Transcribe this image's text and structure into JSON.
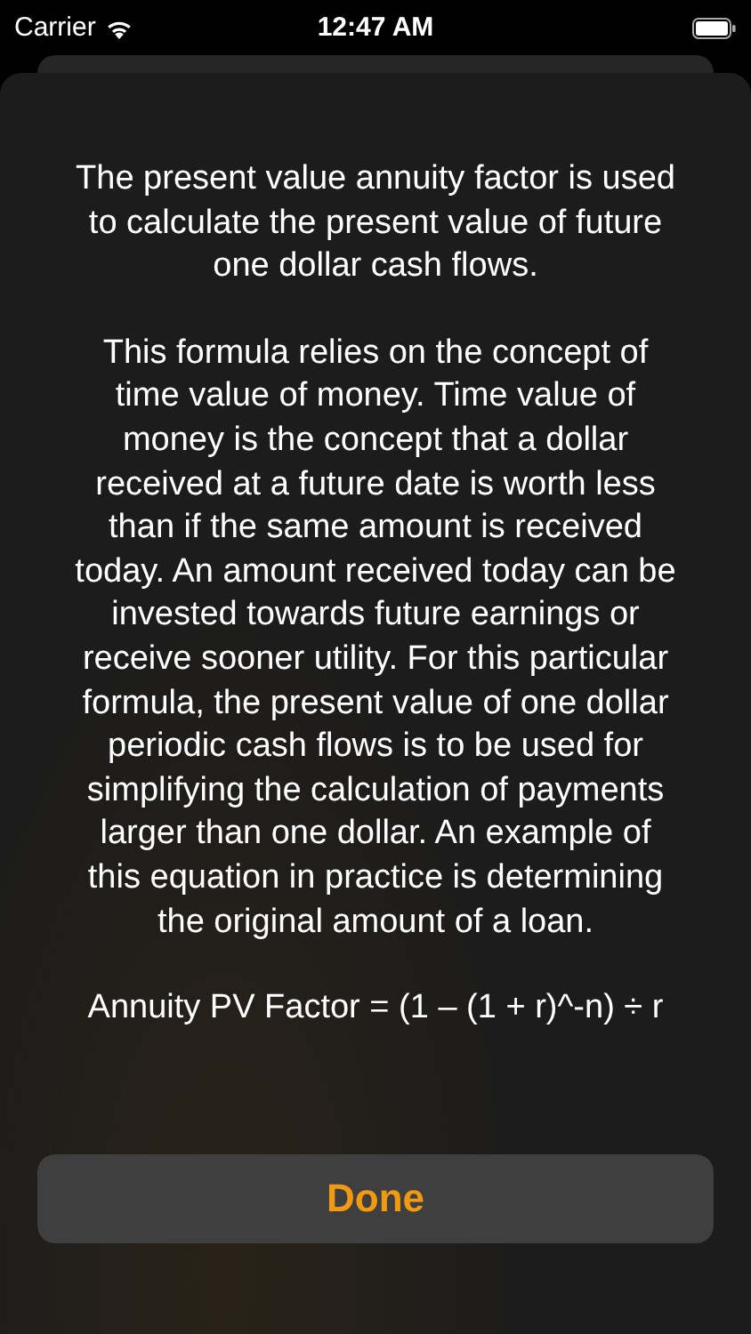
{
  "status_bar": {
    "carrier": "Carrier",
    "time": "12:47 AM"
  },
  "sheet": {
    "paragraphs": [
      "The present value annuity factor is used to calculate the present value of future one dollar cash flows.",
      "This formula relies on the concept of time value of money. Time value of money is the concept that a dollar received at a future date is worth less than if the same amount is received today. An amount received today can be invested towards future earnings or receive sooner utility. For this particular formula, the present value of one dollar periodic cash flows is to be used for simplifying the calculation of payments larger than one dollar. An example of this equation in practice is determining the original amount of a loan."
    ],
    "formula": "Annuity PV Factor = (1 – (1 + r)^-n) ÷ r",
    "done_button": "Done"
  }
}
